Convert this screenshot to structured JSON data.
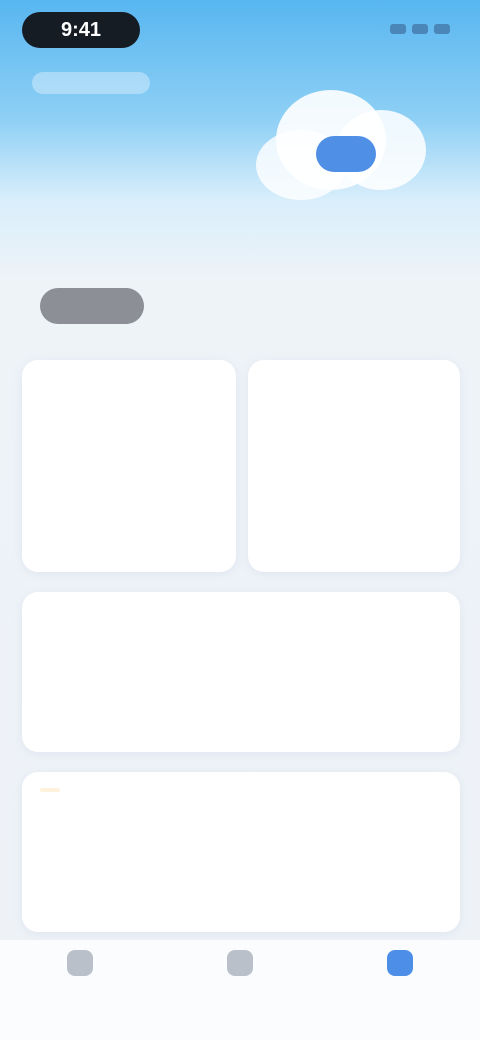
{
  "status_bar": {
    "time": "9:41"
  },
  "header": {
    "caption": ""
  },
  "hero": {
    "title_left": "",
    "title_right": "",
    "subtitle_left": "",
    "subtitle_right": "",
    "button_label": ""
  },
  "cards": [
    {
      "title": "",
      "more": "",
      "value": "",
      "unit": ""
    },
    {
      "title": "",
      "more": "",
      "value": "",
      "unit": ""
    },
    {
      "title": "",
      "more": "",
      "value": "",
      "unit": ""
    },
    {
      "title": "",
      "more": "",
      "value": "",
      "unit": ""
    }
  ],
  "nav": {
    "items": [
      {
        "label": "",
        "icon": "home-icon"
      },
      {
        "label": "",
        "icon": "grid-icon"
      },
      {
        "label": "",
        "icon": "user-icon",
        "active": true
      }
    ]
  },
  "colors": {
    "accent": "#4d8fe8",
    "sky_top": "#58b6f0",
    "card_title_purple": "#6a70e6",
    "card_title_blue": "#4a7fe0",
    "card_title_orange": "#e8a23a"
  }
}
